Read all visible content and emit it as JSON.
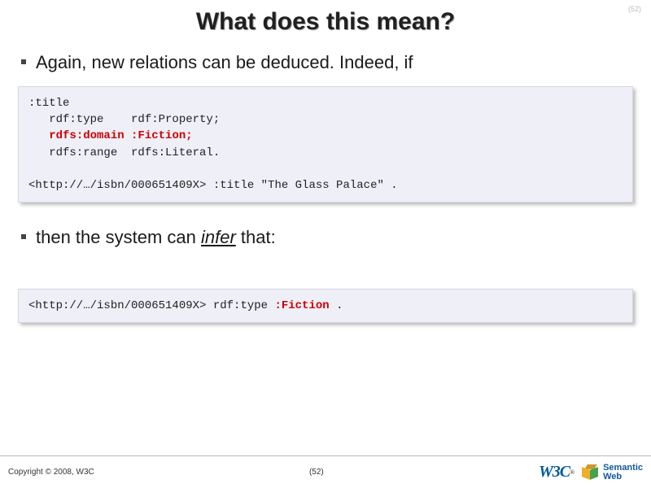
{
  "page_number_top": "(52)",
  "title": "What does this mean?",
  "bullets": {
    "b1": "Again, new relations can be deduced. Indeed, if",
    "b2_prefix": "then the system can ",
    "b2_infer": "infer",
    "b2_suffix": " that:"
  },
  "code1": {
    "l1": ":title",
    "l2a": "   rdf:type    rdf:Property;",
    "l3a": "   ",
    "l3b": "rdfs:domain :Fiction;",
    "l4a": "   rdfs:range  rdfs:Literal.",
    "blank": "",
    "l5": "<http://…/isbn/000651409X> :title \"The Glass Palace\" ."
  },
  "code2": {
    "l1a": "<http://…/isbn/000651409X> rdf:type ",
    "l1b": ":Fiction",
    "l1c": " ."
  },
  "footer": {
    "copyright": "Copyright © 2008, W3C",
    "pagenum": "(52)",
    "sw_top": "Semantic",
    "sw_bottom": "Web"
  }
}
